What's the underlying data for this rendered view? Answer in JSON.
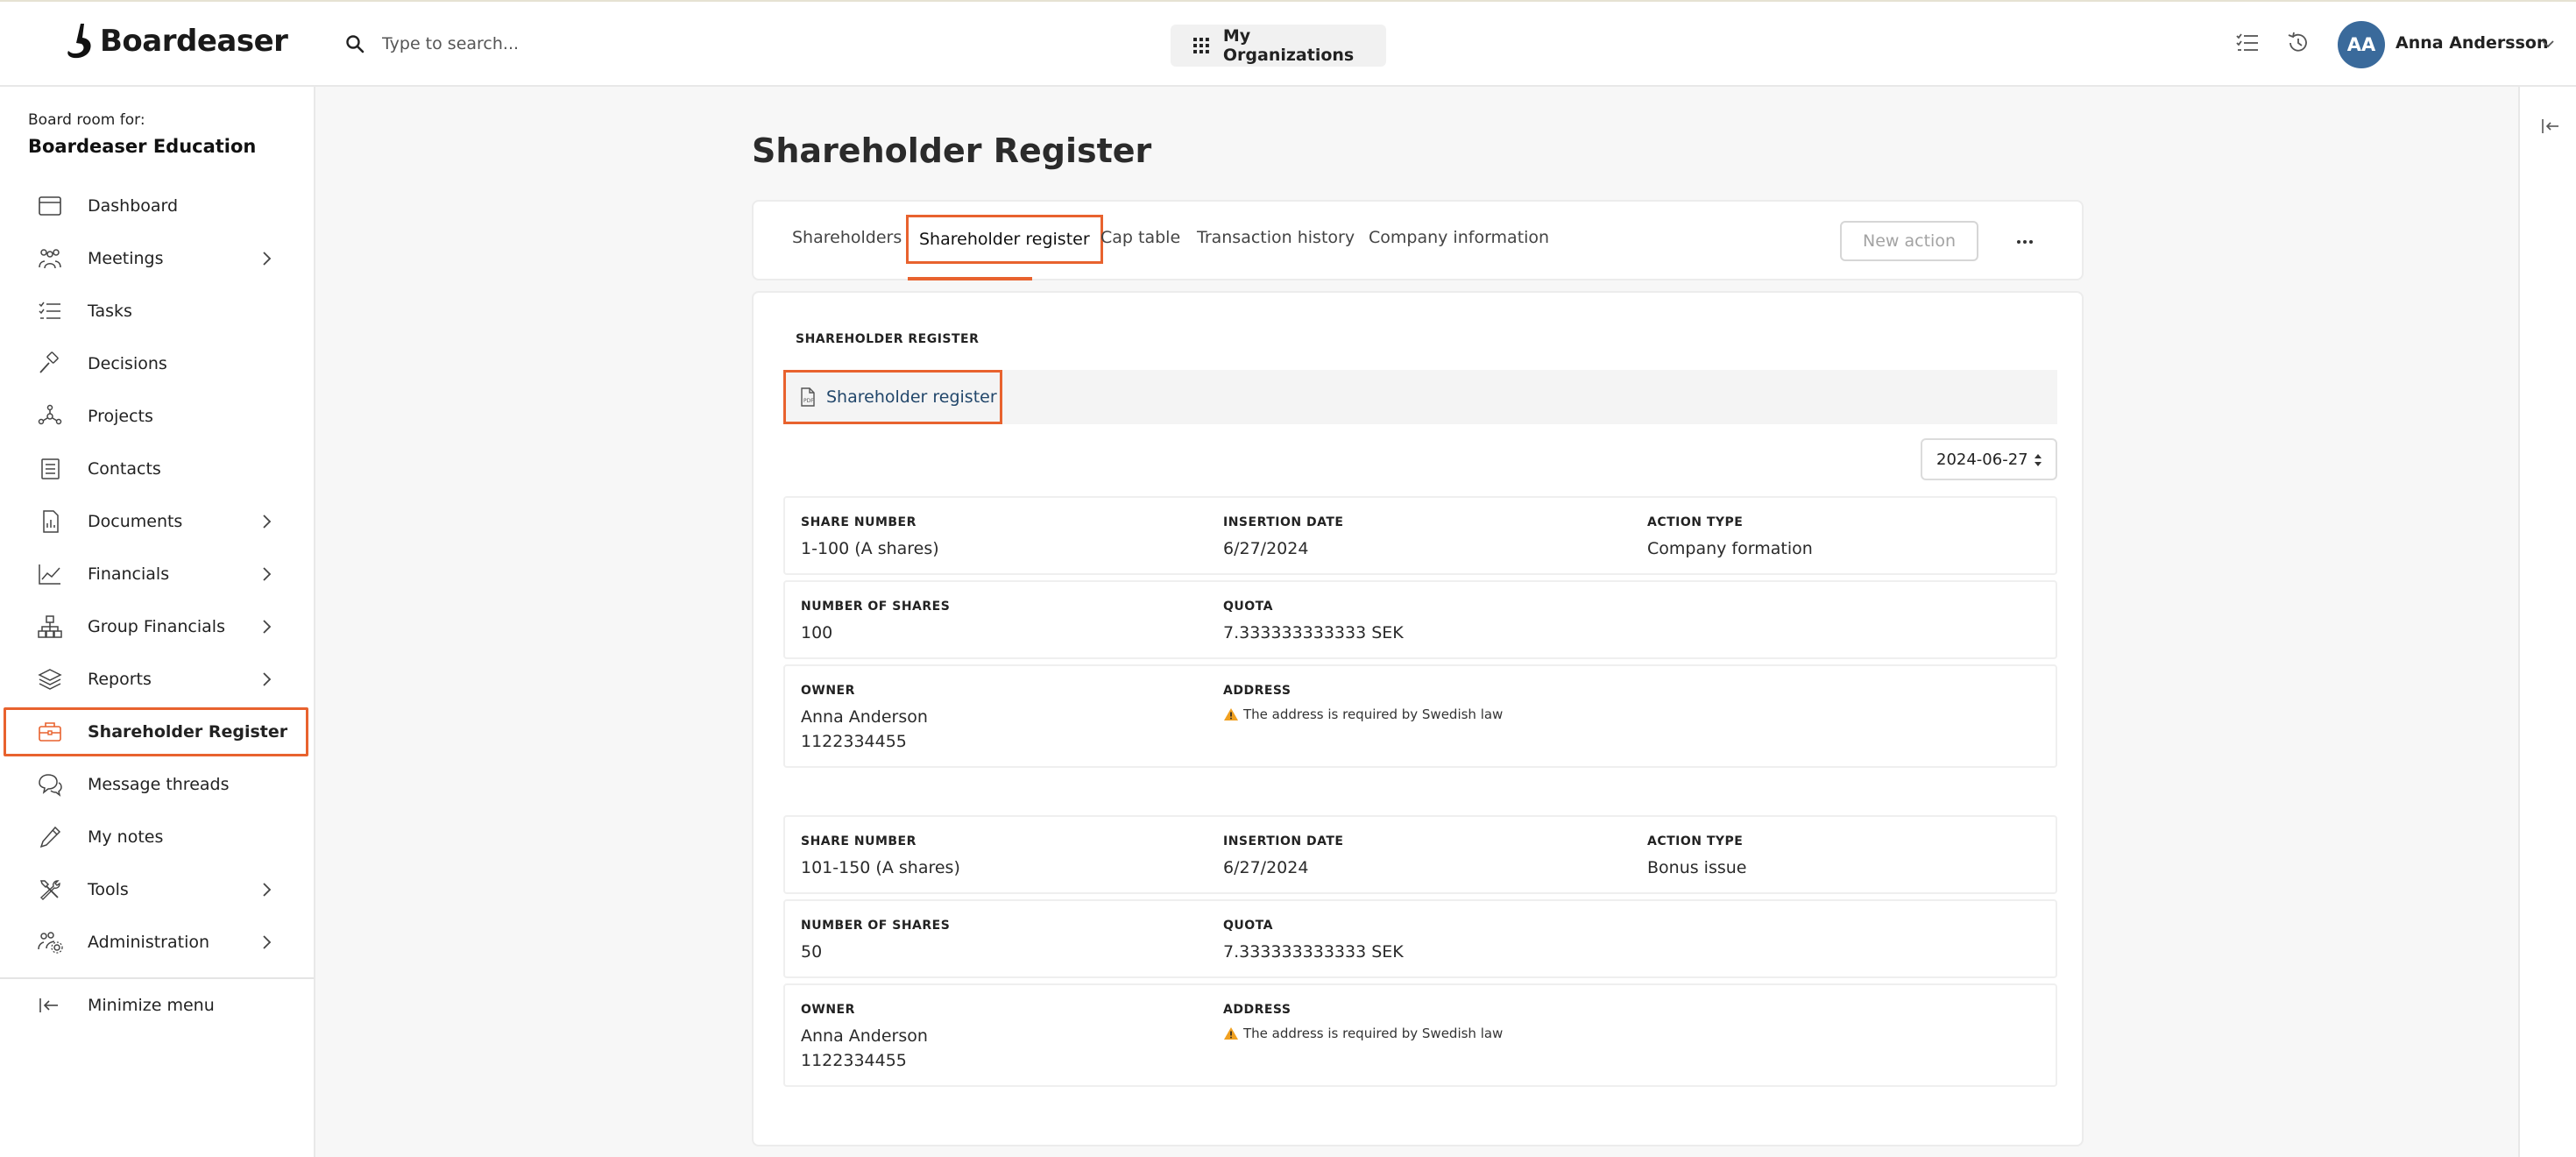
{
  "app": {
    "logo_text": "Boardeaser",
    "search_placeholder": "Type to search...",
    "org_button_label": "My Organizations",
    "user": {
      "initials": "AA",
      "name": "Anna Andersson"
    },
    "accent_color": "#e8622e",
    "avatar_color": "#3a6a9b"
  },
  "sidebar": {
    "board_room_label": "Board room for:",
    "board_room_name": "Boardeaser Education",
    "items": [
      {
        "label": "Dashboard",
        "icon": "dashboard-icon",
        "has_children": false
      },
      {
        "label": "Meetings",
        "icon": "meetings-icon",
        "has_children": true
      },
      {
        "label": "Tasks",
        "icon": "tasks-icon",
        "has_children": false
      },
      {
        "label": "Decisions",
        "icon": "gavel-icon",
        "has_children": false
      },
      {
        "label": "Projects",
        "icon": "projects-icon",
        "has_children": false
      },
      {
        "label": "Contacts",
        "icon": "contacts-icon",
        "has_children": false
      },
      {
        "label": "Documents",
        "icon": "documents-icon",
        "has_children": true
      },
      {
        "label": "Financials",
        "icon": "chart-line-icon",
        "has_children": true
      },
      {
        "label": "Group Financials",
        "icon": "hierarchy-icon",
        "has_children": true
      },
      {
        "label": "Reports",
        "icon": "layers-icon",
        "has_children": true
      },
      {
        "label": "Shareholder Register",
        "icon": "briefcase-icon",
        "has_children": false,
        "active": true
      },
      {
        "label": "Message threads",
        "icon": "chat-icon",
        "has_children": false
      },
      {
        "label": "My notes",
        "icon": "pencil-icon",
        "has_children": false
      },
      {
        "label": "Tools",
        "icon": "tools-icon",
        "has_children": true
      },
      {
        "label": "Administration",
        "icon": "users-gear-icon",
        "has_children": true
      }
    ],
    "minimize_label": "Minimize menu"
  },
  "main": {
    "page_title": "Shareholder Register",
    "tabs": [
      {
        "label": "Shareholders"
      },
      {
        "label": "Shareholder register",
        "active": true
      },
      {
        "label": "Cap table"
      },
      {
        "label": "Transaction history"
      },
      {
        "label": "Company information"
      }
    ],
    "new_action_label": "New action",
    "more_label": "···",
    "section_title": "SHAREHOLDER REGISTER",
    "file_link_label": "Shareholder register",
    "date_value": "2024-06-27",
    "labels": {
      "share_number": "SHARE NUMBER",
      "insertion_date": "INSERTION DATE",
      "action_type": "ACTION TYPE",
      "number_of_shares": "NUMBER OF SHARES",
      "quota": "QUOTA",
      "owner": "OWNER",
      "address": "ADDRESS"
    },
    "entries": [
      {
        "share_number": "1-100 (A shares)",
        "insertion_date": "6/27/2024",
        "action_type": "Company formation",
        "number_of_shares": "100",
        "quota": "7.333333333333 SEK",
        "owner_name": "Anna Anderson",
        "owner_id": "1122334455",
        "address_warning": "The address is required by Swedish law"
      },
      {
        "share_number": "101-150 (A shares)",
        "insertion_date": "6/27/2024",
        "action_type": "Bonus issue",
        "number_of_shares": "50",
        "quota": "7.333333333333 SEK",
        "owner_name": "Anna Anderson",
        "owner_id": "1122334455",
        "address_warning": "The address is required by Swedish law"
      }
    ]
  }
}
